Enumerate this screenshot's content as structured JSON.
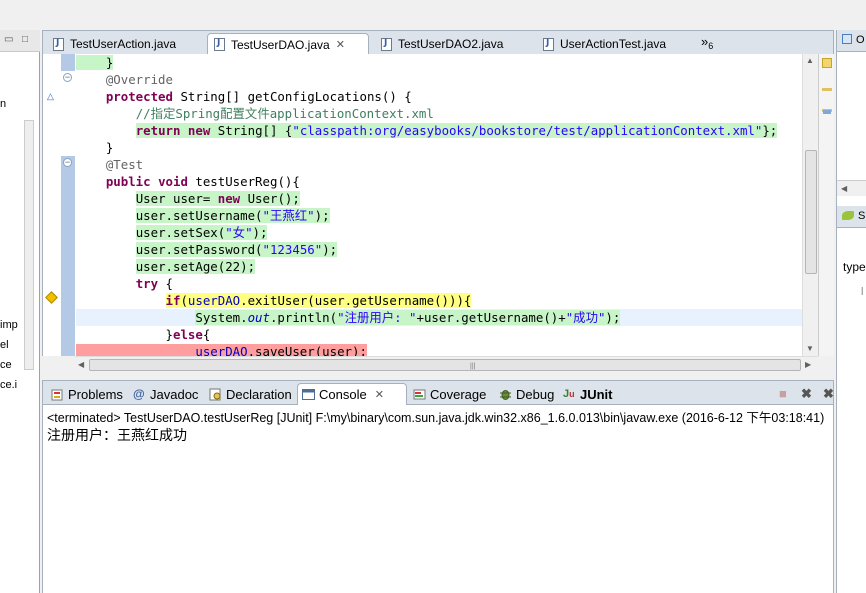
{
  "editor": {
    "tabs": [
      {
        "label": "TestUserAction.java",
        "active": false,
        "icon": "java-file-icon"
      },
      {
        "label": "TestUserDAO.java",
        "active": true,
        "icon": "java-file-icon",
        "close": "✕"
      },
      {
        "label": "TestUserDAO2.java",
        "active": false,
        "icon": "java-file-icon"
      },
      {
        "label": "UserActionTest.java",
        "active": false,
        "icon": "java-file-icon"
      }
    ],
    "overflow_label": "»",
    "overflow_count": "6",
    "lines": [
      {
        "text": "    }",
        "highlight": "green"
      },
      {
        "text": "    @Override",
        "highlight": "none"
      },
      {
        "text": "    protected String[] getConfigLocations() {",
        "highlight": "none"
      },
      {
        "text": "        //指定Spring配置文件applicationContext.xml",
        "highlight": "none"
      },
      {
        "text": "        return new String[] {\"classpath:org/easybooks/bookstore/test/applicationContext.xml\"};",
        "highlight": "green"
      },
      {
        "text": "    }",
        "highlight": "none"
      },
      {
        "text": "    @Test",
        "highlight": "none"
      },
      {
        "text": "    public void testUserReg(){",
        "highlight": "none"
      },
      {
        "text": "        User user= new User();",
        "highlight": "green"
      },
      {
        "text": "        user.setUsername(\"王燕红\");",
        "highlight": "green"
      },
      {
        "text": "        user.setSex(\"女\");",
        "highlight": "green"
      },
      {
        "text": "        user.setPassword(\"123456\");",
        "highlight": "green"
      },
      {
        "text": "        user.setAge(22);",
        "highlight": "green"
      },
      {
        "text": "        try {",
        "highlight": "none"
      },
      {
        "text": "            if(userDAO.exitUser(user.getUsername())){",
        "highlight": "yellow"
      },
      {
        "text": "                System.out.println(\"注册用户: \"+user.getUsername()+\"成功\");",
        "highlight": "green"
      },
      {
        "text": "            }else{",
        "highlight": "none"
      },
      {
        "text": "                userDAO.saveUser(user);",
        "highlight": "red"
      }
    ]
  },
  "left_panel": {
    "fragments": [
      "n",
      "imp",
      "el",
      "ce",
      "ce.i"
    ]
  },
  "right_panel": {
    "fragments": [
      "O",
      "S",
      "type",
      "l"
    ]
  },
  "bottom": {
    "tabs": [
      {
        "label": "Problems",
        "icon": "problems-icon",
        "active": false
      },
      {
        "label": "Javadoc",
        "icon": "javadoc-icon",
        "active": false
      },
      {
        "label": "Declaration",
        "icon": "declaration-icon",
        "active": false
      },
      {
        "label": "Console",
        "icon": "console-icon",
        "active": true,
        "close": "✕"
      },
      {
        "label": "Coverage",
        "icon": "coverage-icon",
        "active": false
      },
      {
        "label": "Debug",
        "icon": "debug-icon",
        "active": false
      },
      {
        "label": "JUnit",
        "icon": "junit-icon",
        "active": false
      }
    ],
    "console_header": "<terminated> TestUserDAO.testUserReg [JUnit] F:\\my\\binary\\com.sun.java.jdk.win32.x86_1.6.0.013\\bin\\javaw.exe (2016-6-12 下午03:18:41)",
    "console_output": "注册用户：王燕红成功"
  },
  "colors": {
    "coverage_green": "#c8f5c8",
    "coverage_yellow": "#ffff80",
    "coverage_red": "#ff9e9e",
    "keyword": "#7f0055",
    "string": "#2a00ff"
  }
}
